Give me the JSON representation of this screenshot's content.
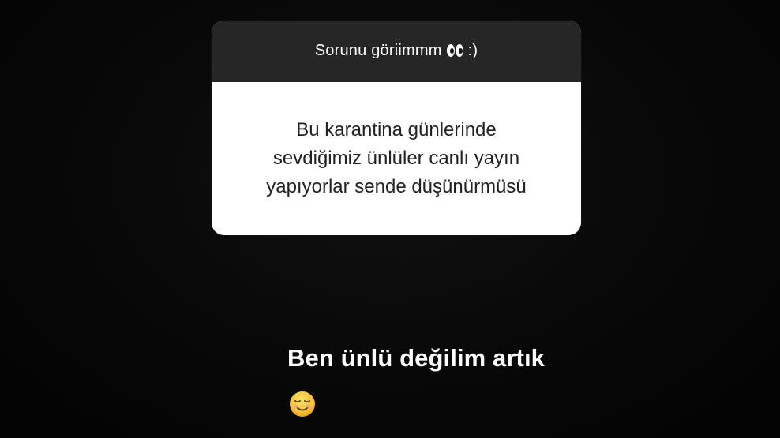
{
  "story": {
    "question_sticker": {
      "header_text": "Sorunu göriimmm",
      "header_suffix": ":)",
      "header_emoji": "eyes-emoji",
      "question": "Bu karantina günlerinde\nsevdiğimiz ünlüler canlı yayın\nyapıyorlar sende düşünürmüsü"
    },
    "reply": {
      "text": "Ben ünlü değilim artık",
      "emoji": "smiling-face-emoji"
    }
  },
  "colors": {
    "background": "#080808",
    "card_header": "#262626",
    "card_body": "#ffffff",
    "question_text": "#222222",
    "reply_text": "#ffffff"
  }
}
